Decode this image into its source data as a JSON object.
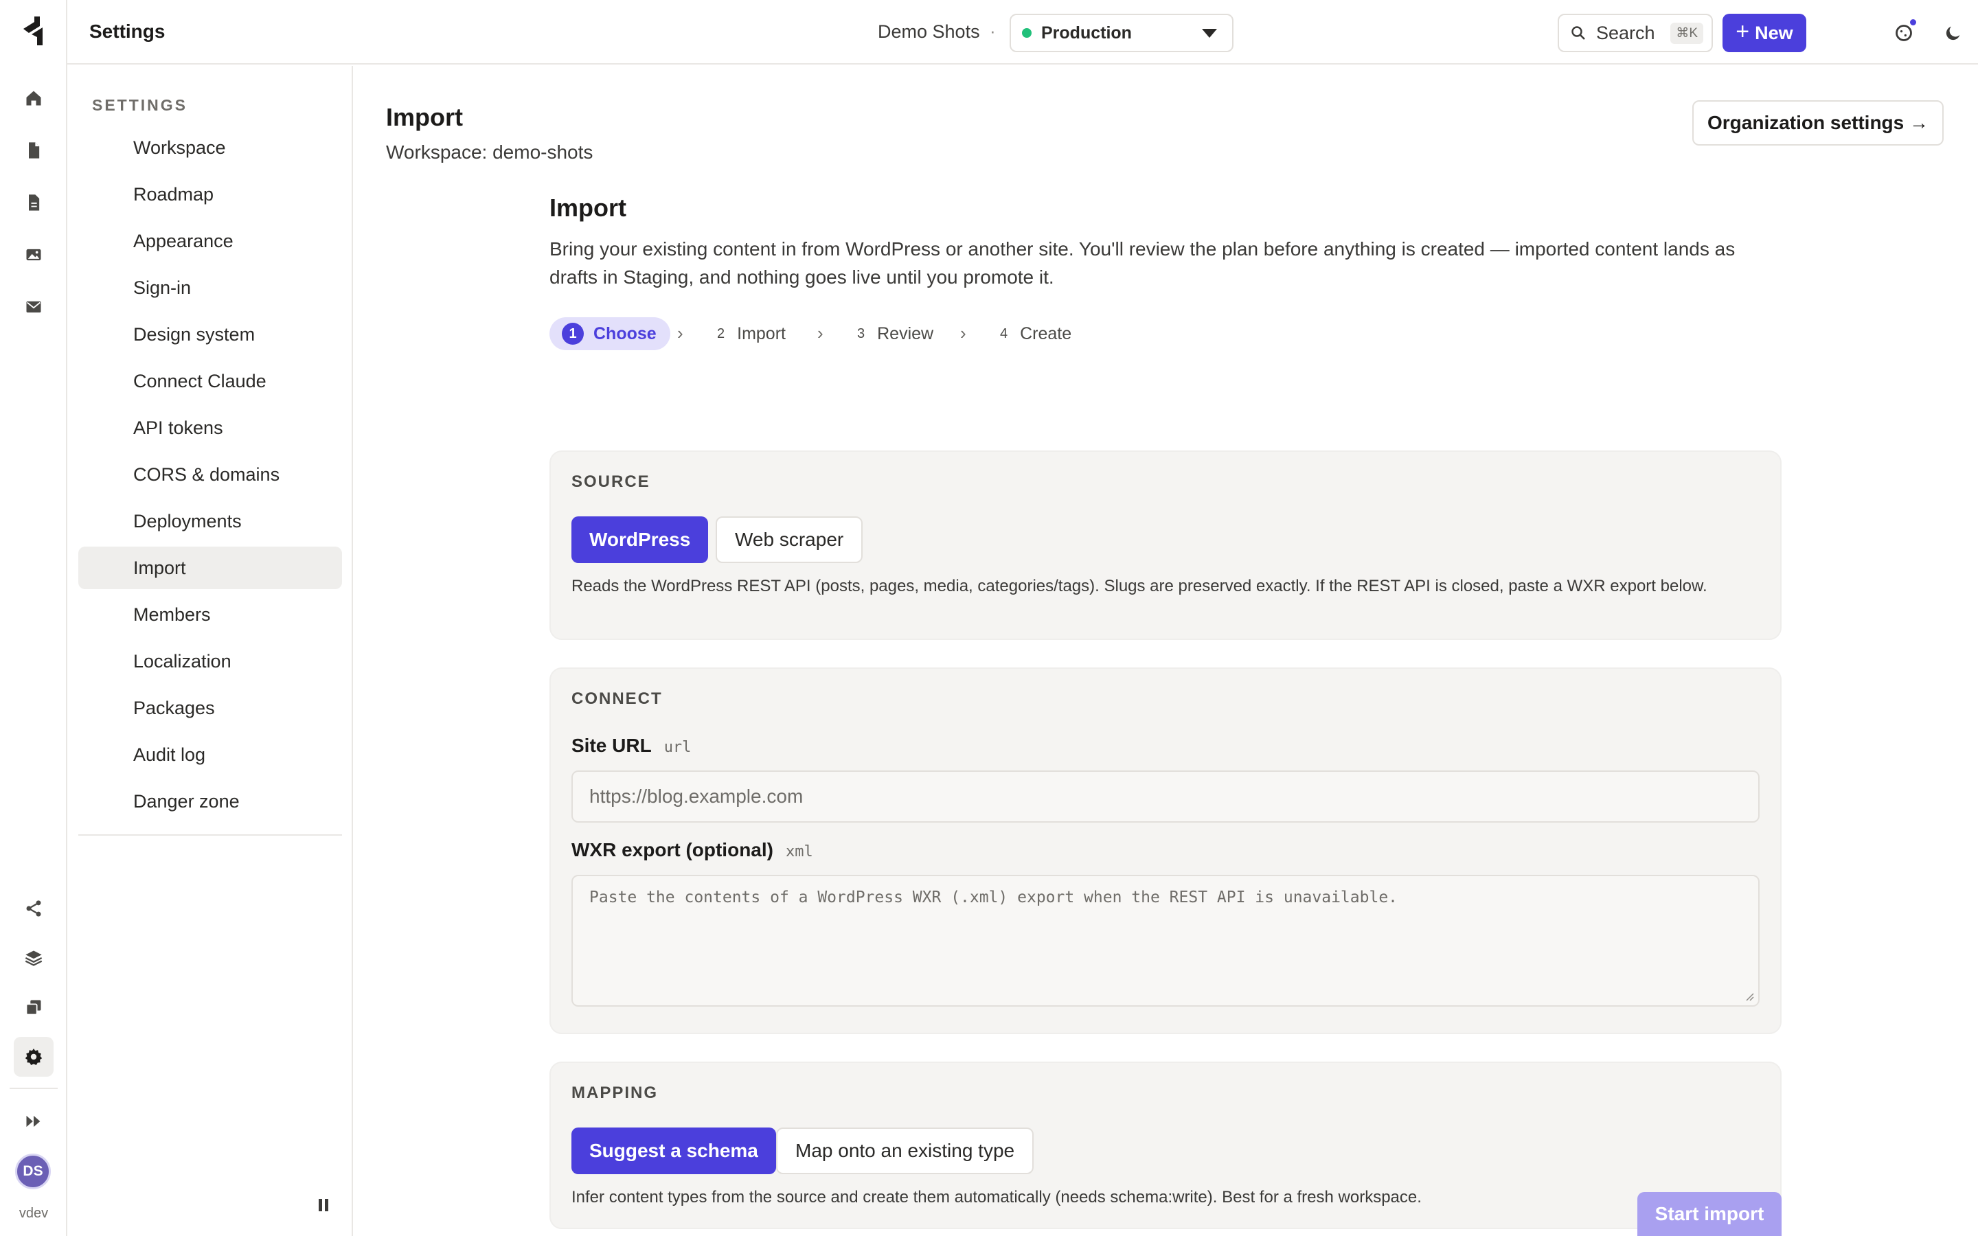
{
  "topbar": {
    "title": "Settings",
    "workspace_name": "Demo Shots",
    "separator": "·",
    "environment": "Production",
    "search_label": "Search",
    "search_shortcut": "⌘K",
    "new_label": "New",
    "help_label": "?"
  },
  "rail": {
    "user_initials": "DS",
    "version": "vdev"
  },
  "sidebar": {
    "header": "SETTINGS",
    "items": [
      {
        "label": "Workspace"
      },
      {
        "label": "Roadmap"
      },
      {
        "label": "Appearance"
      },
      {
        "label": "Sign-in"
      },
      {
        "label": "Design system"
      },
      {
        "label": "Connect Claude"
      },
      {
        "label": "API tokens"
      },
      {
        "label": "CORS & domains"
      },
      {
        "label": "Deployments"
      },
      {
        "label": "Import"
      },
      {
        "label": "Members"
      },
      {
        "label": "Localization"
      },
      {
        "label": "Packages"
      },
      {
        "label": "Audit log"
      },
      {
        "label": "Danger zone"
      }
    ],
    "active_item": "Import"
  },
  "page": {
    "title": "Import",
    "subtitle": "Workspace: demo-shots",
    "org_settings_label": "Organization settings →"
  },
  "import": {
    "title": "Import",
    "description": "Bring your existing content in from WordPress or another site. You'll review the plan before anything is created — imported content lands as drafts in Staging, and nothing goes live until you promote it.",
    "steps": [
      {
        "num": "1",
        "label": "Choose"
      },
      {
        "num": "2",
        "label": "Import"
      },
      {
        "num": "3",
        "label": "Review"
      },
      {
        "num": "4",
        "label": "Create"
      }
    ],
    "chevron": "›",
    "source": {
      "label": "SOURCE",
      "option_selected": "WordPress",
      "option_other": "Web scraper",
      "help": "Reads the WordPress REST API (posts, pages, media, categories/tags). Slugs are preserved exactly. If the REST API is closed, paste a WXR export below."
    },
    "connect": {
      "label": "CONNECT",
      "site_url_label": "Site URL",
      "site_url_hint": "url",
      "site_url_placeholder": "https://blog.example.com",
      "wxr_label": "WXR export (optional)",
      "wxr_hint": "xml",
      "wxr_placeholder": "Paste the contents of a WordPress WXR (.xml) export when the REST API is unavailable."
    },
    "mapping": {
      "label": "MAPPING",
      "option_selected": "Suggest a schema",
      "option_other": "Map onto an existing type",
      "help": "Infer content types from the source and create them automatically (needs schema:write). Best for a fresh workspace."
    },
    "start_label": "Start import"
  },
  "colors": {
    "accent": "#4b3fdc",
    "accent_soft": "#e3e0fb",
    "env_status": "#21c07a",
    "card_bg": "#f5f4f2"
  }
}
